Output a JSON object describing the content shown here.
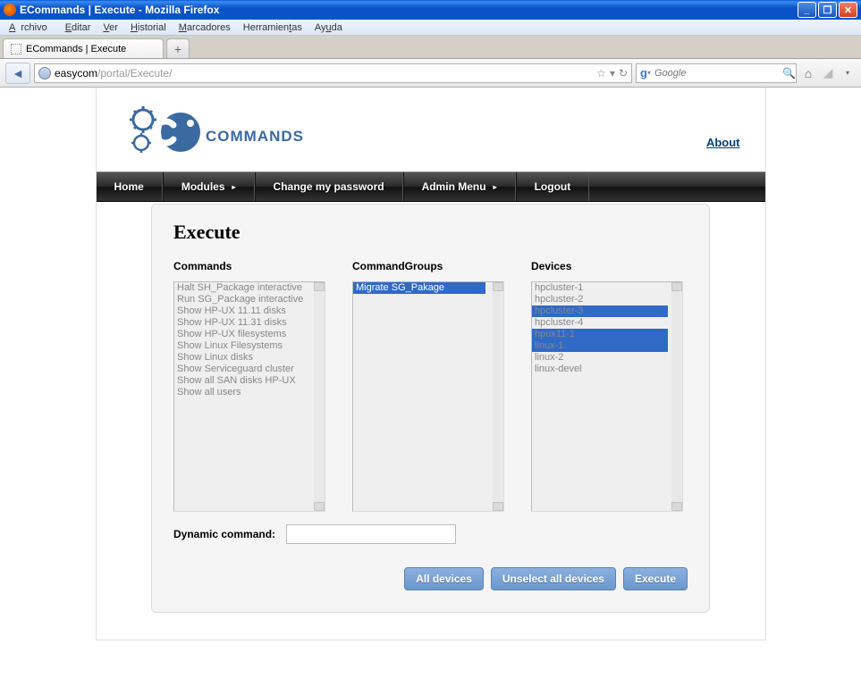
{
  "window": {
    "title": "ECommands | Execute - Mozilla Firefox"
  },
  "menubar": {
    "archivo": "Archivo",
    "editar": "Editar",
    "ver": "Ver",
    "historial": "Historial",
    "marcadores": "Marcadores",
    "herramientas": "Herramientas",
    "ayuda": "Ayuda"
  },
  "tab": {
    "title": "ECommands | Execute"
  },
  "url": {
    "host": "easycom",
    "path": "/portal/Execute/"
  },
  "search": {
    "placeholder": "Google"
  },
  "page": {
    "logo_text": "COMMANDS",
    "about": "About"
  },
  "nav": {
    "home": "Home",
    "modules": "Modules",
    "change_pw": "Change my password",
    "admin": "Admin Menu",
    "logout": "Logout"
  },
  "execute": {
    "title": "Execute",
    "commands_label": "Commands",
    "groups_label": "CommandGroups",
    "devices_label": "Devices",
    "commands": [
      "Halt SH_Package interactive",
      "Run SG_Package interactive",
      "Show HP-UX 11.11 disks",
      "Show HP-UX 11.31 disks",
      "Show HP-UX filesystems",
      "Show Linux Filesystems",
      "Show Linux disks",
      "Show Serviceguard cluster",
      "Show all SAN disks HP-UX",
      "Show all users"
    ],
    "groups": [
      {
        "label": "Migrate SG_Pakage",
        "selected": true
      }
    ],
    "devices": [
      {
        "label": "hpcluster-1",
        "selected": false
      },
      {
        "label": "hpcluster-2",
        "selected": false
      },
      {
        "label": "hpcluster-3",
        "selected": true
      },
      {
        "label": "hpcluster-4",
        "selected": false
      },
      {
        "label": "hpux11-1",
        "selected": true
      },
      {
        "label": "linux-1",
        "selected": true
      },
      {
        "label": "linux-2",
        "selected": false
      },
      {
        "label": "linux-devel",
        "selected": false
      }
    ],
    "dynamic_label": "Dynamic command:",
    "dynamic_value": "",
    "btn_all": "All devices",
    "btn_unselect": "Unselect all devices",
    "btn_execute": "Execute"
  }
}
